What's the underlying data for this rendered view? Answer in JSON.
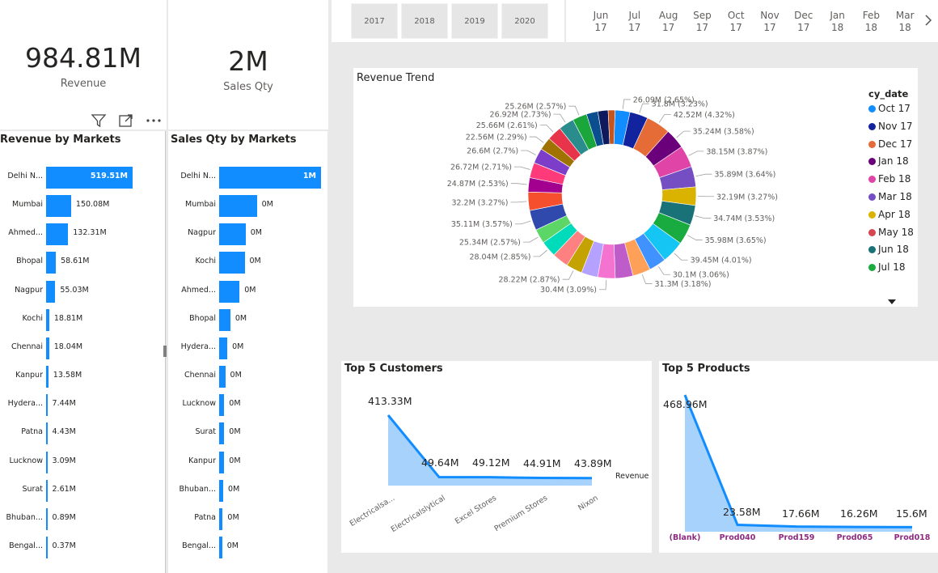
{
  "cards": {
    "revenue": {
      "value": "984.81M",
      "label": "Revenue"
    },
    "sales_qty": {
      "value": "2M",
      "label": "Sales Qty"
    }
  },
  "year_slicer": [
    "2017",
    "2018",
    "2019",
    "2020"
  ],
  "month_slicer": [
    [
      "Jun",
      "17"
    ],
    [
      "Jul",
      "17"
    ],
    [
      "Aug",
      "17"
    ],
    [
      "Sep",
      "17"
    ],
    [
      "Oct",
      "17"
    ],
    [
      "Nov",
      "17"
    ],
    [
      "Dec",
      "17"
    ],
    [
      "Jan",
      "18"
    ],
    [
      "Feb",
      "18"
    ],
    [
      "Mar",
      "18"
    ]
  ],
  "revenue_by_markets": {
    "title": "Revenue by Markets",
    "rows": [
      {
        "label": "Delhi N...",
        "value": 519.51,
        "text": "519.51M"
      },
      {
        "label": "Mumbai",
        "value": 150.08,
        "text": "150.08M"
      },
      {
        "label": "Ahmed...",
        "value": 132.31,
        "text": "132.31M"
      },
      {
        "label": "Bhopal",
        "value": 58.61,
        "text": "58.61M"
      },
      {
        "label": "Nagpur",
        "value": 55.03,
        "text": "55.03M"
      },
      {
        "label": "Kochi",
        "value": 18.81,
        "text": "18.81M"
      },
      {
        "label": "Chennai",
        "value": 18.04,
        "text": "18.04M"
      },
      {
        "label": "Kanpur",
        "value": 13.58,
        "text": "13.58M"
      },
      {
        "label": "Hydera...",
        "value": 7.44,
        "text": "7.44M"
      },
      {
        "label": "Patna",
        "value": 4.43,
        "text": "4.43M"
      },
      {
        "label": "Lucknow",
        "value": 3.09,
        "text": "3.09M"
      },
      {
        "label": "Surat",
        "value": 2.61,
        "text": "2.61M"
      },
      {
        "label": "Bhuban...",
        "value": 0.89,
        "text": "0.89M"
      },
      {
        "label": "Bengal...",
        "value": 0.37,
        "text": "0.37M"
      }
    ]
  },
  "sales_qty_by_markets": {
    "title": "Sales Qty by Markets",
    "rows": [
      {
        "label": "Delhi N...",
        "value": 1.0,
        "text": "1M"
      },
      {
        "label": "Mumbai",
        "value": 0.37,
        "text": "0M"
      },
      {
        "label": "Nagpur",
        "value": 0.26,
        "text": "0M"
      },
      {
        "label": "Kochi",
        "value": 0.25,
        "text": "0M"
      },
      {
        "label": "Ahmed...",
        "value": 0.2,
        "text": "0M"
      },
      {
        "label": "Bhopal",
        "value": 0.11,
        "text": "0M"
      },
      {
        "label": "Hydera...",
        "value": 0.08,
        "text": "0M"
      },
      {
        "label": "Chennai",
        "value": 0.06,
        "text": "0M"
      },
      {
        "label": "Lucknow",
        "value": 0.05,
        "text": "0M"
      },
      {
        "label": "Surat",
        "value": 0.05,
        "text": "0M"
      },
      {
        "label": "Kanpur",
        "value": 0.05,
        "text": "0M"
      },
      {
        "label": "Bhuban...",
        "value": 0.04,
        "text": "0M"
      },
      {
        "label": "Patna",
        "value": 0.035,
        "text": "0M"
      },
      {
        "label": "Bengal...",
        "value": 0.03,
        "text": "0M"
      }
    ]
  },
  "chart_data": [
    {
      "type": "pie",
      "title": "Revenue Trend",
      "legend_title": "cy_date",
      "legend_placement": "right",
      "legend": [
        {
          "name": "Oct 17",
          "color": "#118dff"
        },
        {
          "name": "Nov 17",
          "color": "#12239e"
        },
        {
          "name": "Dec 17",
          "color": "#e66c37"
        },
        {
          "name": "Jan 18",
          "color": "#6b007b"
        },
        {
          "name": "Feb 18",
          "color": "#e044a7"
        },
        {
          "name": "Mar 18",
          "color": "#744ec2"
        },
        {
          "name": "Apr 18",
          "color": "#d9b300"
        },
        {
          "name": "May 18",
          "color": "#d64550"
        },
        {
          "name": "Jun 18",
          "color": "#197278"
        },
        {
          "name": "Jul 18",
          "color": "#1aab40"
        }
      ],
      "slices": [
        {
          "value": 26.09,
          "label": "26.09M (2.65%)",
          "color": "#118dff"
        },
        {
          "value": 31.8,
          "label": "31.8M (3.23%)",
          "color": "#12239e"
        },
        {
          "value": 42.52,
          "label": "42.52M (4.32%)",
          "color": "#e66c37"
        },
        {
          "value": 35.24,
          "label": "35.24M (3.58%)",
          "color": "#6b007b"
        },
        {
          "value": 38.15,
          "label": "38.15M (3.87%)",
          "color": "#e044a7"
        },
        {
          "value": 35.89,
          "label": "35.89M (3.64%)",
          "color": "#744ec2"
        },
        {
          "value": 32.19,
          "label": "32.19M (3.27%)",
          "color": "#d9b300"
        },
        {
          "value": 34.74,
          "label": "34.74M (3.53%)",
          "color": "#197278"
        },
        {
          "value": 35.98,
          "label": "35.98M (3.65%)",
          "color": "#1aab40"
        },
        {
          "value": 39.45,
          "label": "39.45M (4.01%)",
          "color": "#15c6f4"
        },
        {
          "value": 30.1,
          "label": "30.1M (3.06%)",
          "color": "#4092ff"
        },
        {
          "value": 31.3,
          "label": "31.3M (3.18%)",
          "color": "#ffa058"
        },
        {
          "value": 31.0,
          "label": "",
          "color": "#be5dc9"
        },
        {
          "value": 30.4,
          "label": "30.4M (3.09%)",
          "color": "#f472d0"
        },
        {
          "value": 29.0,
          "label": "",
          "color": "#b5a1ff"
        },
        {
          "value": 28.22,
          "label": "28.22M (2.87%)",
          "color": "#c4a200"
        },
        {
          "value": 28.5,
          "label": "",
          "color": "#ff8080"
        },
        {
          "value": 28.04,
          "label": "28.04M (2.85%)",
          "color": "#00dbbc"
        },
        {
          "value": 25.34,
          "label": "25.34M (2.57%)",
          "color": "#5bd667"
        },
        {
          "value": 35.11,
          "label": "35.11M (3.57%)",
          "color": "#3049ad"
        },
        {
          "value": 32.2,
          "label": "32.2M (3.27%)",
          "color": "#f64f2e"
        },
        {
          "value": 24.87,
          "label": "24.87M (2.53%)",
          "color": "#a3008f"
        },
        {
          "value": 26.72,
          "label": "26.72M (2.71%)",
          "color": "#ff3a7a"
        },
        {
          "value": 26.6,
          "label": "26.6M (2.7%)",
          "color": "#7c3ec9"
        },
        {
          "value": 22.56,
          "label": "22.56M (2.29%)",
          "color": "#a07300"
        },
        {
          "value": 25.66,
          "label": "25.66M (2.61%)",
          "color": "#e8344a"
        },
        {
          "value": 26.92,
          "label": "26.92M (2.73%)",
          "color": "#2a8c8c"
        },
        {
          "value": 25.26,
          "label": "25.26M (2.57%)",
          "color": "#1aa63a"
        },
        {
          "value": 20.0,
          "label": "",
          "color": "#0a4e8f"
        },
        {
          "value": 18.0,
          "label": "",
          "color": "#0f1a5e"
        },
        {
          "value": 12.0,
          "label": "",
          "color": "#c4551e"
        }
      ]
    },
    {
      "type": "area",
      "title": "Top 5 Customers",
      "categories": [
        "Electricalsa...",
        "Electricalslytical",
        "Excel Stores",
        "Premium Stores",
        "Nixon"
      ],
      "series": [
        {
          "name": "Revenue",
          "values": [
            413.33,
            49.64,
            49.12,
            44.91,
            43.89
          ],
          "labels": [
            "413.33M",
            "49.64M",
            "49.12M",
            "44.91M",
            "43.89M"
          ]
        }
      ]
    },
    {
      "type": "area",
      "title": "Top 5 Products",
      "categories": [
        "(Blank)",
        "Prod040",
        "Prod159",
        "Prod065",
        "Prod018"
      ],
      "series": [
        {
          "values": [
            468.96,
            23.58,
            17.66,
            16.26,
            15.6
          ],
          "labels": [
            "468.96M",
            "23.58M",
            "17.66M",
            "16.26M",
            "15.6M"
          ]
        }
      ]
    }
  ]
}
